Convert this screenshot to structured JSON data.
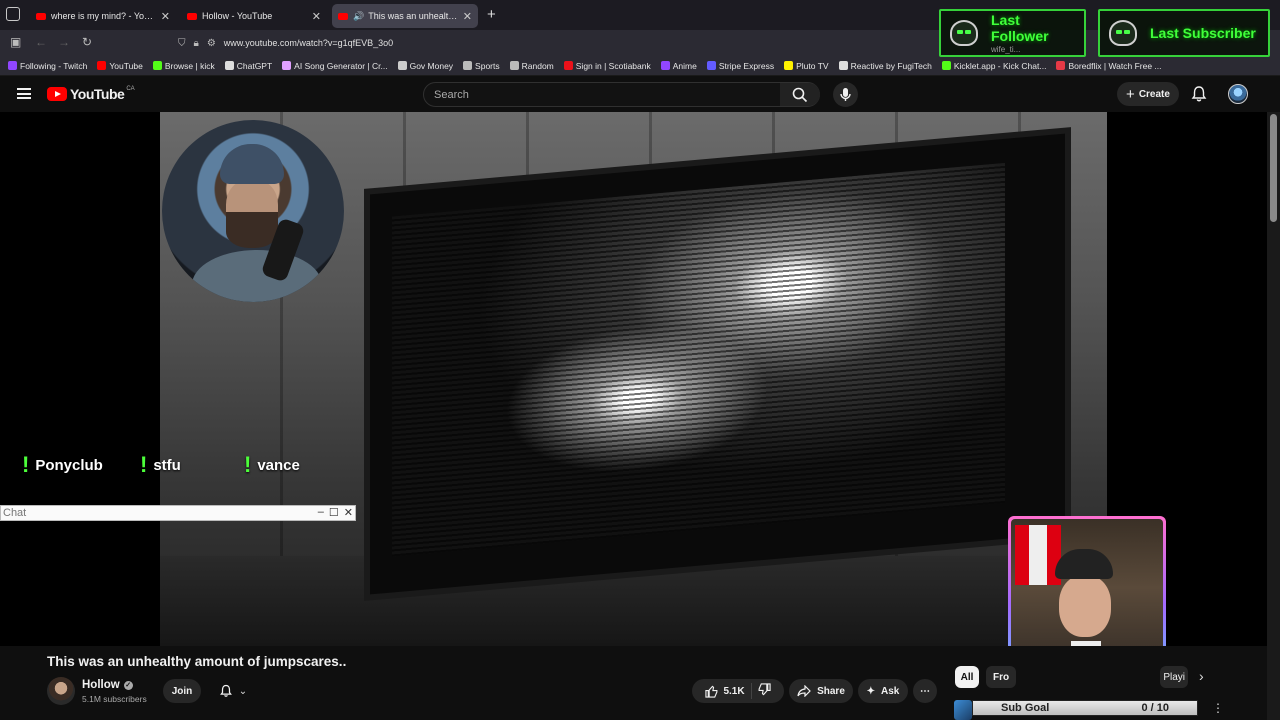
{
  "browser": {
    "tabs": [
      {
        "title": "where is my mind? - YouTube",
        "active": false
      },
      {
        "title": "Hollow - YouTube",
        "active": false
      },
      {
        "title": "This was an unhealthy amo",
        "active": true
      }
    ],
    "url": "www.youtube.com/watch?v=g1qfEVB_3o0",
    "bookmarks": [
      {
        "label": "Following - Twitch",
        "color": "#9146ff"
      },
      {
        "label": "YouTube",
        "color": "#ff0000"
      },
      {
        "label": "Browse | kick",
        "color": "#53fc18"
      },
      {
        "label": "ChatGPT",
        "color": "#dddddd"
      },
      {
        "label": "AI Song Generator | Cr...",
        "color": "#e0a0ff"
      },
      {
        "label": "Gov Money",
        "color": "#cccccc"
      },
      {
        "label": "Sports",
        "color": "#bbbbbb"
      },
      {
        "label": "Random",
        "color": "#bbbbbb"
      },
      {
        "label": "Sign in | Scotiabank",
        "color": "#ec111a"
      },
      {
        "label": "Anime",
        "color": "#9146ff"
      },
      {
        "label": "Stripe Express",
        "color": "#635bff"
      },
      {
        "label": "Pluto TV",
        "color": "#fff200"
      },
      {
        "label": "Reactive by FugiTech",
        "color": "#dddddd"
      },
      {
        "label": "Kicklet.app - Kick Chat...",
        "color": "#53fc18"
      },
      {
        "label": "Boredflix | Watch Free ...",
        "color": "#e63946"
      }
    ]
  },
  "overlays": {
    "last_follower": {
      "title": "Last Follower",
      "name": "wife_ti..."
    },
    "last_subscriber": {
      "title": "Last Subscriber"
    },
    "chat_commands": [
      "Ponyclub",
      "stfu",
      "vance"
    ],
    "chat_label": "Chat",
    "sub_goal": {
      "label": "Sub Goal",
      "value": "0 / 10"
    }
  },
  "youtube": {
    "logo": "YouTube",
    "country": "CA",
    "search_placeholder": "Search",
    "create_label": "Create",
    "video": {
      "title": "This was an unhealthy amount of jumpscares..",
      "channel": "Hollow",
      "subscribers": "5.1M subscribers",
      "join_label": "Join",
      "likes": "5.1K",
      "share_label": "Share",
      "ask_label": "Ask"
    },
    "chips": [
      "All",
      "Fro",
      "Playi"
    ]
  },
  "icons": [
    "search-icon",
    "mic-icon",
    "bell-icon",
    "like-icon",
    "dislike-icon",
    "share-icon",
    "sparkle-icon",
    "more-icon",
    "chevron-right-icon",
    "verified-icon"
  ]
}
